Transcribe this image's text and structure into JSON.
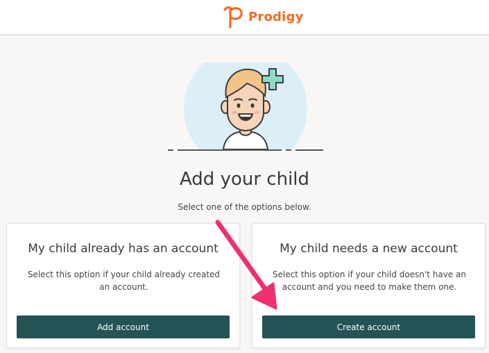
{
  "header": {
    "brand_name": "Prodigy",
    "brand_color": "#f26b21"
  },
  "hero": {
    "illustration": "child-avatar-with-plus-icon",
    "title": "Add your child",
    "subtitle": "Select one of the options below."
  },
  "options": [
    {
      "title": "My child already has an account",
      "description": "Select this option if your child already created an account.",
      "button_label": "Add account"
    },
    {
      "title": "My child needs a new account",
      "description": "Select this option if your child doesn't have an account and you need to make them one.",
      "button_label": "Create account"
    }
  ],
  "colors": {
    "button_bg": "#245455",
    "page_bg": "#f8f7f5",
    "annotation_arrow": "#f0306e",
    "plus_icon": "#8fd9c9",
    "avatar_circle": "#dceef7"
  },
  "annotation": {
    "arrow_icon": "pink-arrow-icon"
  }
}
